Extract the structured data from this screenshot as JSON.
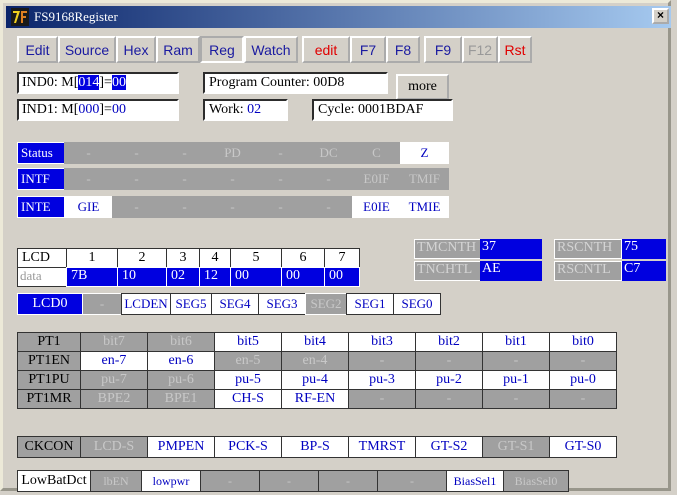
{
  "window": {
    "title": "FS9168Register"
  },
  "menu": [
    {
      "label": "Edit",
      "w": 41
    },
    {
      "label": "Source",
      "w": 58
    },
    {
      "label": "Hex",
      "w": 40
    },
    {
      "label": "Ram",
      "w": 44
    },
    {
      "label": "Reg",
      "w": 44
    },
    {
      "label": "Watch",
      "w": 54
    },
    {
      "label": "edit",
      "w": 48
    },
    {
      "label": "F7",
      "w": 36
    },
    {
      "label": "F8",
      "w": 34
    },
    {
      "label": "F9",
      "w": 38
    },
    {
      "label": "F12",
      "w": 36
    },
    {
      "label": "Rst",
      "w": 34
    }
  ],
  "ind0": {
    "label": "IND0: M[",
    "hi": "014",
    "mid": "]=",
    "val": "00"
  },
  "ind1": {
    "label": "IND1: M[",
    "hi": "000",
    "mid": "]=",
    "val": "00"
  },
  "pc": {
    "label": "Program Counter: 00D8"
  },
  "more": "more",
  "work": {
    "label": "Work:",
    "val": "02"
  },
  "cycle": {
    "label": "Cycle: 0001BDAF"
  },
  "status": {
    "name": "Status",
    "bits": [
      "-",
      "-",
      "-",
      "PD",
      "-",
      "DC",
      "C",
      "Z"
    ]
  },
  "intf": {
    "name": "INTF",
    "bits": [
      "-",
      "-",
      "-",
      "-",
      "-",
      "-",
      "E0IF",
      "TMIF"
    ]
  },
  "inte": {
    "name": "INTE",
    "bits": [
      "GIE",
      "-",
      "-",
      "-",
      "-",
      "-",
      "E0IE",
      "TMIE"
    ]
  },
  "lcd": {
    "header": [
      "LCD",
      "1",
      "2",
      "3",
      "4",
      "5",
      "6",
      "7"
    ],
    "data_label": "data",
    "data": [
      "7B",
      "10",
      "02",
      "12",
      "00",
      "00",
      "00"
    ]
  },
  "tm": {
    "cnth_label": "TMCNTH",
    "cnth": "37",
    "cntl_label": "TNCHTL",
    "cntl": "AE"
  },
  "rs": {
    "cnth_label": "RSCNTH",
    "cnth": "75",
    "cntl_label": "RSCNTL",
    "cntl": "C7"
  },
  "lcd0": {
    "name": "LCD0",
    "bits": [
      "-",
      "LCDEN",
      "SEG5",
      "SEG4",
      "SEG3",
      "SEG2",
      "SEG1",
      "SEG0"
    ]
  },
  "pt1": {
    "name": "PT1",
    "bits": [
      "bit7",
      "bit6",
      "bit5",
      "bit4",
      "bit3",
      "bit2",
      "bit1",
      "bit0"
    ]
  },
  "pt1en": {
    "name": "PT1EN",
    "bits": [
      "en-7",
      "en-6",
      "en-5",
      "en-4",
      "-",
      "-",
      "-",
      "-"
    ]
  },
  "pt1pu": {
    "name": "PT1PU",
    "bits": [
      "pu-7",
      "pu-6",
      "pu-5",
      "pu-4",
      "pu-3",
      "pu-2",
      "pu-1",
      "pu-0"
    ]
  },
  "pt1mr": {
    "name": "PT1MR",
    "bits": [
      "BPE2",
      "BPE1",
      "CH-S",
      "RF-EN",
      "-",
      "-",
      "-",
      "-"
    ]
  },
  "ckcon": {
    "name": "CKCON",
    "bits": [
      "LCD-S",
      "PMPEN",
      "PCK-S",
      "BP-S",
      "TMRST",
      "GT-S2",
      "GT-S1",
      "GT-S0"
    ]
  },
  "lowbat": {
    "name": "LowBatDct",
    "bits": [
      "lbEN",
      "lowpwr",
      "-",
      "-",
      "-",
      "-",
      "BiasSel1",
      "BiasSel0"
    ]
  }
}
